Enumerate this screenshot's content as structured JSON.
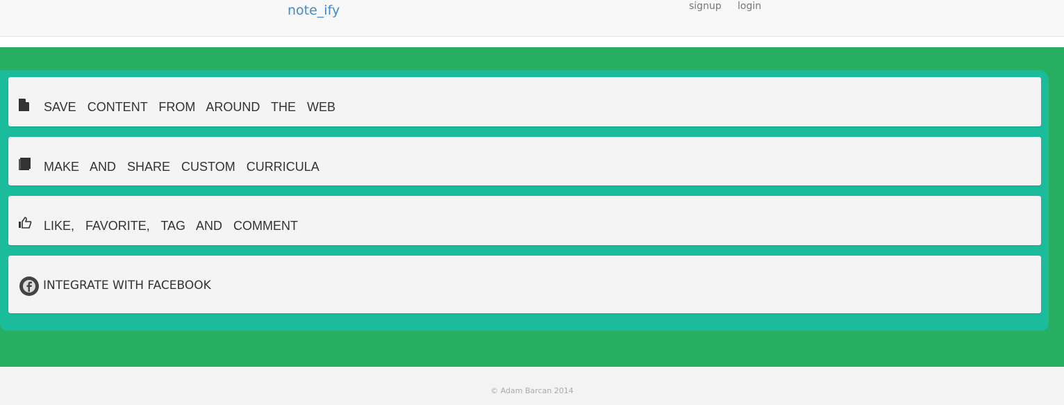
{
  "header": {
    "brand": "note_ify",
    "nav": [
      {
        "label": "signup"
      },
      {
        "label": "login"
      }
    ]
  },
  "features": [
    {
      "icon": "file-icon",
      "label": "SAVE CONTENT FROM AROUND THE WEB"
    },
    {
      "icon": "book-icon",
      "label": "MAKE AND SHARE CUSTOM CURRICULA"
    },
    {
      "icon": "thumbs-up-icon",
      "label": "LIKE, FAVORITE, TAG AND COMMENT"
    },
    {
      "icon": "facebook-icon",
      "label": "INTEGRATE WITH FACEBOOK"
    }
  ],
  "footer": {
    "copyright": "© Adam Barcan 2014"
  },
  "colors": {
    "brand": "#428bca",
    "green": "#27ae60",
    "teal": "#1abc9c"
  }
}
